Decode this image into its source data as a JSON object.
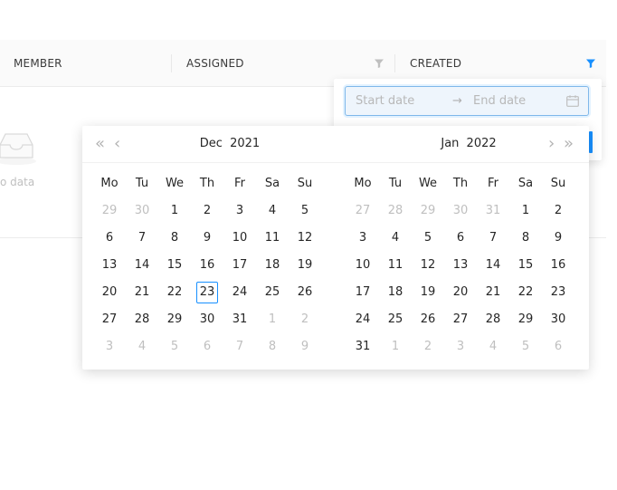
{
  "table": {
    "columns": [
      {
        "label": "MEMBER"
      },
      {
        "label": "ASSIGNED"
      },
      {
        "label": "CREATED"
      }
    ],
    "empty_text": "o data"
  },
  "filter": {
    "start_placeholder": "Start date",
    "end_placeholder": "End date",
    "separator": "→"
  },
  "calendar": {
    "nav": {
      "super_prev": "«",
      "prev": "‹",
      "next": "›",
      "super_next": "»"
    },
    "weekdays": [
      "Mo",
      "Tu",
      "We",
      "Th",
      "Fr",
      "Sa",
      "Su"
    ],
    "left": {
      "month": "Dec",
      "year": "2021",
      "weeks": [
        [
          {
            "d": "29",
            "m": 1
          },
          {
            "d": "30",
            "m": 1
          },
          {
            "d": "1"
          },
          {
            "d": "2"
          },
          {
            "d": "3"
          },
          {
            "d": "4"
          },
          {
            "d": "5"
          }
        ],
        [
          {
            "d": "6"
          },
          {
            "d": "7"
          },
          {
            "d": "8"
          },
          {
            "d": "9"
          },
          {
            "d": "10"
          },
          {
            "d": "11"
          },
          {
            "d": "12"
          }
        ],
        [
          {
            "d": "13"
          },
          {
            "d": "14"
          },
          {
            "d": "15"
          },
          {
            "d": "16"
          },
          {
            "d": "17"
          },
          {
            "d": "18"
          },
          {
            "d": "19"
          }
        ],
        [
          {
            "d": "20"
          },
          {
            "d": "21"
          },
          {
            "d": "22"
          },
          {
            "d": "23",
            "today": 1
          },
          {
            "d": "24"
          },
          {
            "d": "25"
          },
          {
            "d": "26"
          }
        ],
        [
          {
            "d": "27"
          },
          {
            "d": "28"
          },
          {
            "d": "29"
          },
          {
            "d": "30"
          },
          {
            "d": "31"
          },
          {
            "d": "1",
            "m": 1
          },
          {
            "d": "2",
            "m": 1
          }
        ],
        [
          {
            "d": "3",
            "m": 1
          },
          {
            "d": "4",
            "m": 1
          },
          {
            "d": "5",
            "m": 1
          },
          {
            "d": "6",
            "m": 1
          },
          {
            "d": "7",
            "m": 1
          },
          {
            "d": "8",
            "m": 1
          },
          {
            "d": "9",
            "m": 1
          }
        ]
      ]
    },
    "right": {
      "month": "Jan",
      "year": "2022",
      "weeks": [
        [
          {
            "d": "27",
            "m": 1
          },
          {
            "d": "28",
            "m": 1
          },
          {
            "d": "29",
            "m": 1
          },
          {
            "d": "30",
            "m": 1
          },
          {
            "d": "31",
            "m": 1
          },
          {
            "d": "1"
          },
          {
            "d": "2"
          }
        ],
        [
          {
            "d": "3"
          },
          {
            "d": "4"
          },
          {
            "d": "5"
          },
          {
            "d": "6"
          },
          {
            "d": "7"
          },
          {
            "d": "8"
          },
          {
            "d": "9"
          }
        ],
        [
          {
            "d": "10"
          },
          {
            "d": "11"
          },
          {
            "d": "12"
          },
          {
            "d": "13"
          },
          {
            "d": "14"
          },
          {
            "d": "15"
          },
          {
            "d": "16"
          }
        ],
        [
          {
            "d": "17"
          },
          {
            "d": "18"
          },
          {
            "d": "19"
          },
          {
            "d": "20"
          },
          {
            "d": "21"
          },
          {
            "d": "22"
          },
          {
            "d": "23"
          }
        ],
        [
          {
            "d": "24"
          },
          {
            "d": "25"
          },
          {
            "d": "26"
          },
          {
            "d": "27"
          },
          {
            "d": "28"
          },
          {
            "d": "29"
          },
          {
            "d": "30"
          }
        ],
        [
          {
            "d": "31"
          },
          {
            "d": "1",
            "m": 1
          },
          {
            "d": "2",
            "m": 1
          },
          {
            "d": "3",
            "m": 1
          },
          {
            "d": "4",
            "m": 1
          },
          {
            "d": "5",
            "m": 1
          },
          {
            "d": "6",
            "m": 1
          }
        ]
      ]
    }
  },
  "colors": {
    "accent": "#1890ff",
    "filter_inactive": "#bfbfbf",
    "muted_text": "#bfbfbf"
  },
  "icons": {
    "assigned_filter": "filter-icon",
    "created_filter": "filter-icon-active",
    "date_input": "calendar-icon",
    "empty": "inbox-icon"
  }
}
